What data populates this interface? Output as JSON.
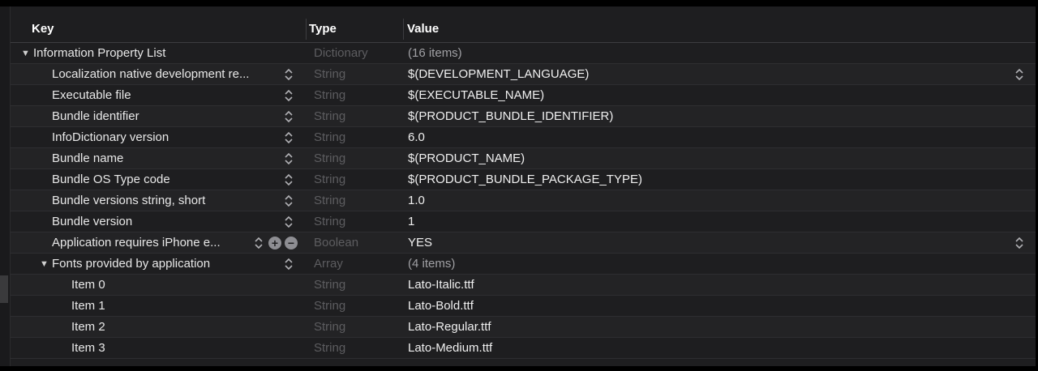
{
  "header": {
    "key": "Key",
    "type": "Type",
    "value": "Value"
  },
  "rows": [
    {
      "key": "Information Property List",
      "type": "Dictionary",
      "value": "(16 items)"
    },
    {
      "key": "Localization native development re...",
      "type": "String",
      "value": "$(DEVELOPMENT_LANGUAGE)"
    },
    {
      "key": "Executable file",
      "type": "String",
      "value": "$(EXECUTABLE_NAME)"
    },
    {
      "key": "Bundle identifier",
      "type": "String",
      "value": "$(PRODUCT_BUNDLE_IDENTIFIER)"
    },
    {
      "key": "InfoDictionary version",
      "type": "String",
      "value": "6.0"
    },
    {
      "key": "Bundle name",
      "type": "String",
      "value": "$(PRODUCT_NAME)"
    },
    {
      "key": "Bundle OS Type code",
      "type": "String",
      "value": "$(PRODUCT_BUNDLE_PACKAGE_TYPE)"
    },
    {
      "key": "Bundle versions string, short",
      "type": "String",
      "value": "1.0"
    },
    {
      "key": "Bundle version",
      "type": "String",
      "value": "1"
    },
    {
      "key": "Application requires iPhone e...",
      "type": "Boolean",
      "value": "YES"
    },
    {
      "key": "Fonts provided by application",
      "type": "Array",
      "value": "(4 items)"
    },
    {
      "key": "Item 0",
      "type": "String",
      "value": "Lato-Italic.ttf"
    },
    {
      "key": "Item 1",
      "type": "String",
      "value": "Lato-Bold.ttf"
    },
    {
      "key": "Item 2",
      "type": "String",
      "value": "Lato-Regular.ttf"
    },
    {
      "key": "Item 3",
      "type": "String",
      "value": "Lato-Medium.ttf"
    }
  ],
  "icons": {
    "disclosure": "disclosure-triangle-icon",
    "stepper": "up-down-chevron-icon",
    "add": "plus-circle-icon",
    "remove": "minus-circle-icon"
  },
  "colors": {
    "background": "#1e1e20",
    "type_text": "#5d5d60",
    "key_text": "#e8e8e8",
    "value_text": "#f0f0f0"
  }
}
